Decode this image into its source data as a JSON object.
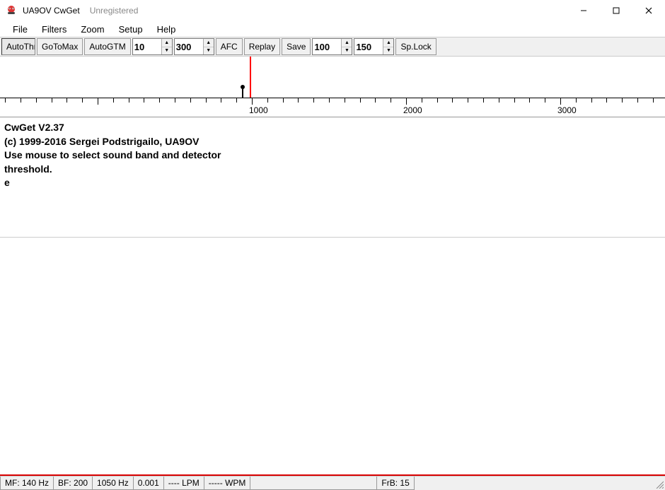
{
  "titlebar": {
    "title": "UA9OV CwGet",
    "subtitle": "Unregistered"
  },
  "menu": {
    "file": "File",
    "filters": "Filters",
    "zoom": "Zoom",
    "setup": "Setup",
    "help": "Help"
  },
  "toolbar": {
    "autothr": "AutoThr",
    "gotomax": "GoToMax",
    "autogtm": "AutoGTM",
    "spin1": "10",
    "spin2": "300",
    "afc": "AFC",
    "replay": "Replay",
    "save": "Save",
    "spin3": "100",
    "spin4": "150",
    "splock": "Sp.Lock"
  },
  "ruler": {
    "labels": [
      "1000",
      "2000",
      "3000"
    ]
  },
  "rx_text": "CwGet  V2.37\n(c) 1999-2016 Sergei Podstrigailo, UA9OV\nUse mouse to select sound band and detector\nthreshold.\n e",
  "status": {
    "mf": "MF: 140 Hz",
    "bf": "BF: 200",
    "freq": "1050 Hz",
    "val": "0.001",
    "lpm": "---- LPM",
    "wpm": "----- WPM",
    "frb": "FrB: 15"
  }
}
